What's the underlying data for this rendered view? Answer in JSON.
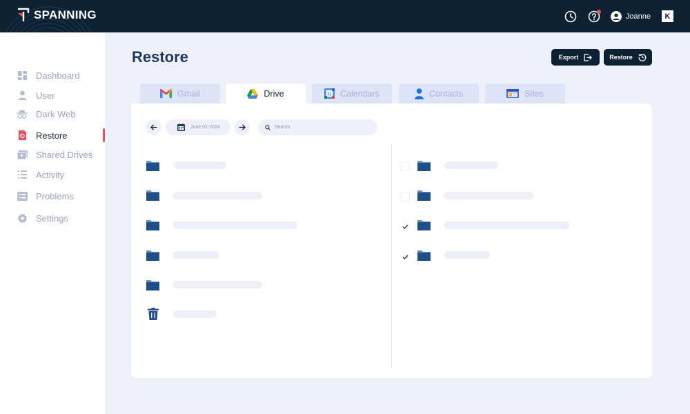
{
  "app": {
    "brand": "SPANNING",
    "brand_mark": "K"
  },
  "header": {
    "user_name": "Joanne"
  },
  "sidebar": {
    "items": [
      {
        "label": "Dashboard",
        "icon": "dashboard-icon"
      },
      {
        "label": "User",
        "icon": "user-icon"
      },
      {
        "label": "Dark Web",
        "icon": "spy-icon"
      },
      {
        "label": "Restore",
        "icon": "restore-icon",
        "active": true
      },
      {
        "label": "Shared Drives",
        "icon": "shared-drives-icon"
      },
      {
        "label": "Activity",
        "icon": "activity-icon"
      },
      {
        "label": "Problems",
        "icon": "problems-icon"
      },
      {
        "label": "Settings",
        "icon": "gear-icon"
      }
    ]
  },
  "main": {
    "title": "Restore",
    "export_label": "Export",
    "restore_label": "Restore",
    "tabs": [
      {
        "label": "Gmail",
        "icon": "gmail-icon"
      },
      {
        "label": "Drive",
        "icon": "drive-icon",
        "active": true
      },
      {
        "label": "Calendars",
        "icon": "calendar-icon"
      },
      {
        "label": "Contacts",
        "icon": "contacts-icon"
      },
      {
        "label": "Sites",
        "icon": "sites-icon"
      }
    ],
    "toolbar": {
      "date": "June 01-2024",
      "search_placeholder": "Search"
    },
    "left_list": [
      {
        "icon": "folder-icon"
      },
      {
        "icon": "folder-icon"
      },
      {
        "icon": "folder-icon"
      },
      {
        "icon": "folder-icon"
      },
      {
        "icon": "folder-icon"
      },
      {
        "icon": "trash-icon"
      }
    ],
    "right_list": [
      {
        "icon": "folder-icon",
        "checked": false
      },
      {
        "icon": "folder-icon",
        "checked": false
      },
      {
        "icon": "folder-icon",
        "checked": true
      },
      {
        "icon": "folder-icon",
        "checked": true
      }
    ]
  },
  "colors": {
    "topbar": "#0c2233",
    "accent": "#e8505b",
    "title": "#1e3a5f",
    "folder": "#1f4f8a"
  }
}
